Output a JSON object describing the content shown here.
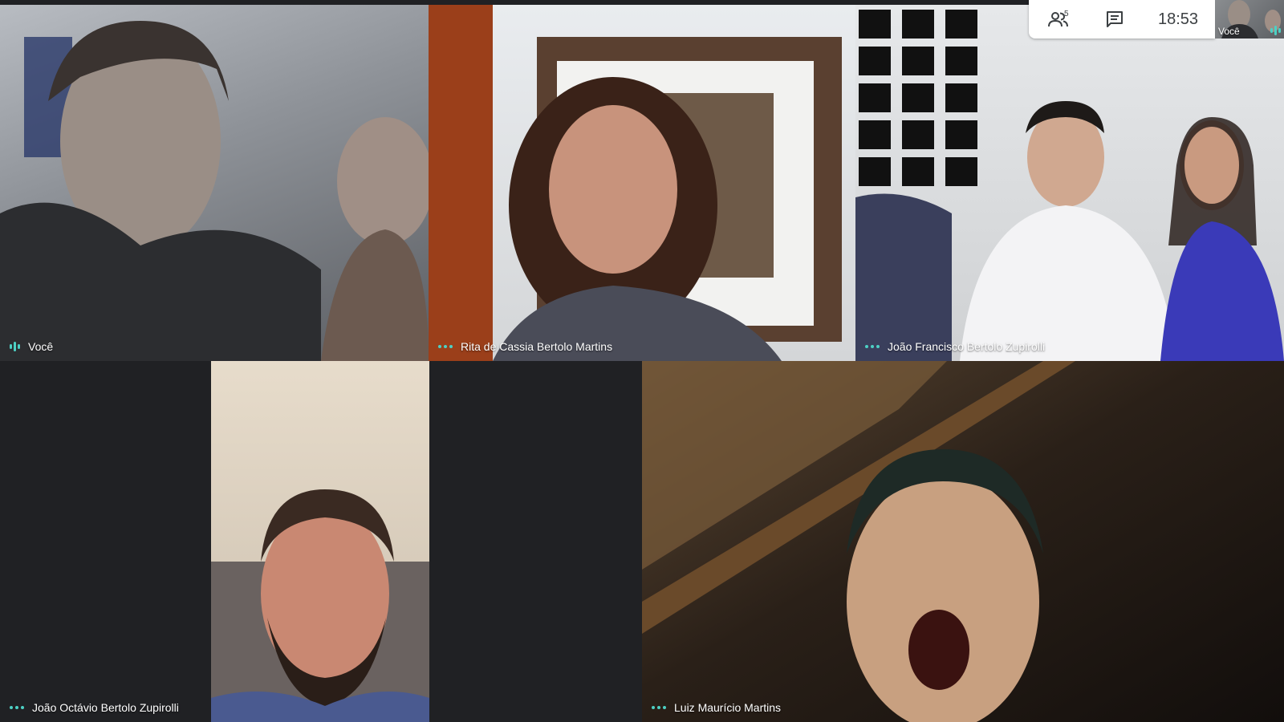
{
  "meeting": {
    "time": "18:53",
    "participant_count": "5"
  },
  "self_preview": {
    "label": "Você"
  },
  "tiles": [
    {
      "name": "Você"
    },
    {
      "name": "Rita de Cassia Bertolo Martins"
    },
    {
      "name": "João Francisco Bertolo Zupirolli"
    },
    {
      "name": "João Octávio Bertolo Zupirolli"
    },
    {
      "name": "Luiz Maurício Martins"
    }
  ],
  "colors": {
    "background": "#202124",
    "accent": "#4dd0c4",
    "panel": "#ffffff"
  },
  "icons": {
    "people": "people-icon",
    "chat": "chat-icon",
    "speaking": "audio-bars-icon",
    "more": "more-dots-icon"
  }
}
